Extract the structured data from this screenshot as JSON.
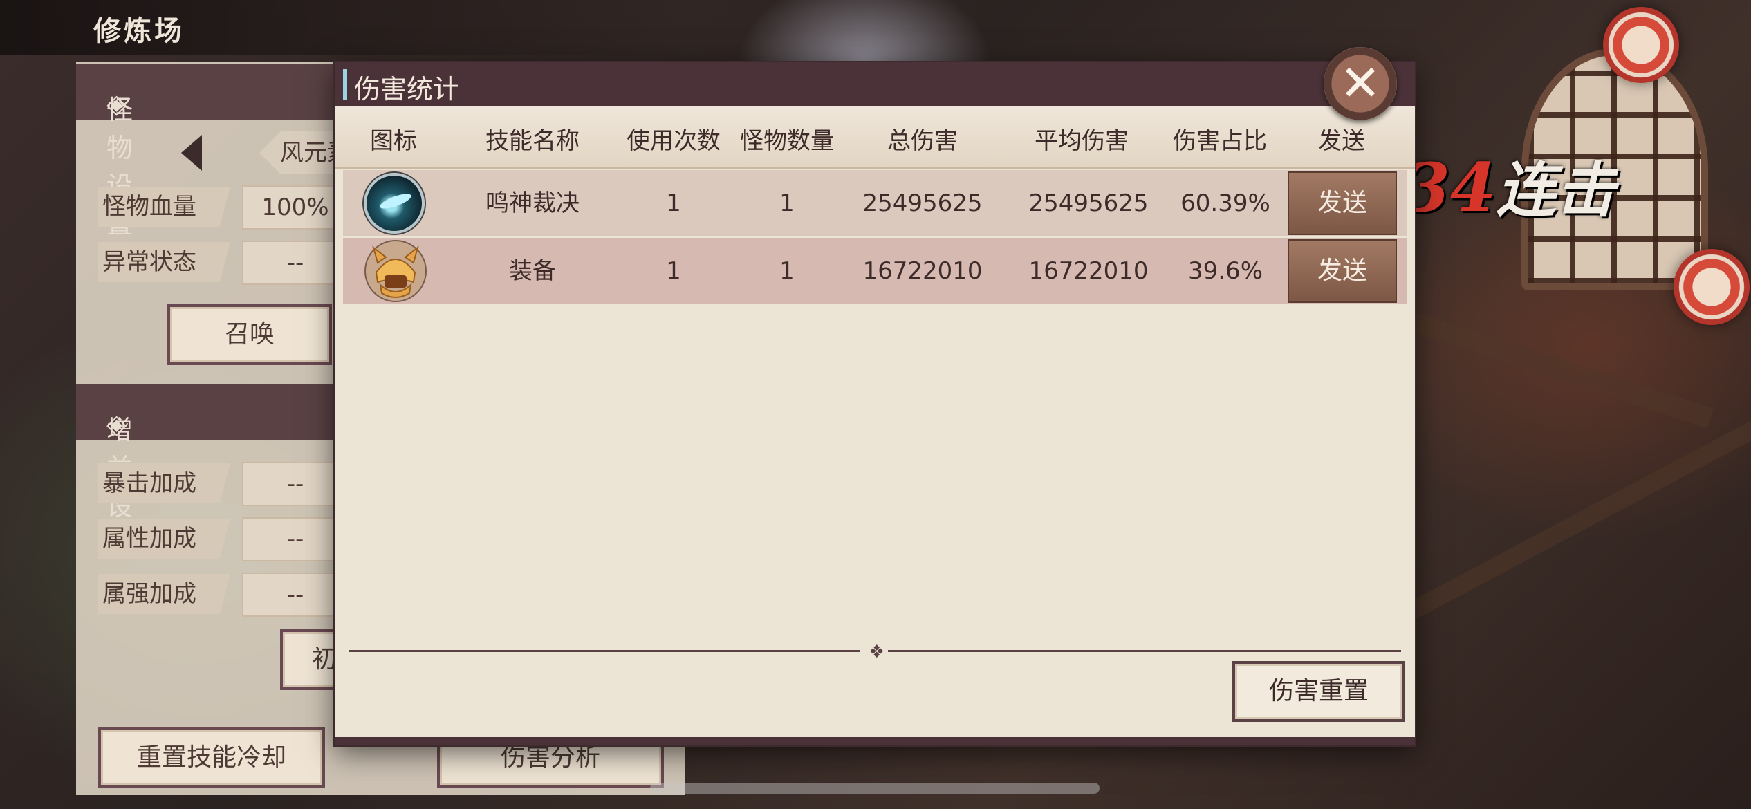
{
  "scene": {
    "title": "修炼场",
    "combo_number": "34",
    "combo_label": "连击"
  },
  "side_panel": {
    "monster_settings_title": "怪物设置",
    "element_chip": "风元素",
    "hp_label": "怪物血量",
    "hp_value": "100%",
    "status_label": "异常状态",
    "status_value": "--",
    "summon_button": "召唤",
    "buff_settings_title": "增益设置",
    "crit_label": "暴击加成",
    "crit_value": "--",
    "attr_label": "属性加成",
    "attr_value": "--",
    "attr_strength_label": "属强加成",
    "attr_strength_value": "--",
    "init_button": "初",
    "reset_cooldown_button": "重置技能冷却",
    "damage_analysis_button": "伤害分析"
  },
  "dialog": {
    "title": "伤害统计",
    "close_icon": "close-x-icon",
    "columns": [
      "图标",
      "技能名称",
      "使用次数",
      "怪物数量",
      "总伤害",
      "平均伤害",
      "伤害占比",
      "发送"
    ],
    "rows": [
      {
        "icon": "ice-slash-skill-icon",
        "skill_name": "鸣神裁决",
        "uses": "1",
        "monsters": "1",
        "total_damage": "25495625",
        "avg_damage": "25495625",
        "ratio": "60.39%",
        "send": "发送"
      },
      {
        "icon": "golden-helmet-equipment-icon",
        "skill_name": "装备",
        "uses": "1",
        "monsters": "1",
        "total_damage": "16722010",
        "avg_damage": "16722010",
        "ratio": "39.6%",
        "send": "发送"
      }
    ],
    "reset_button": "伤害重置"
  }
}
